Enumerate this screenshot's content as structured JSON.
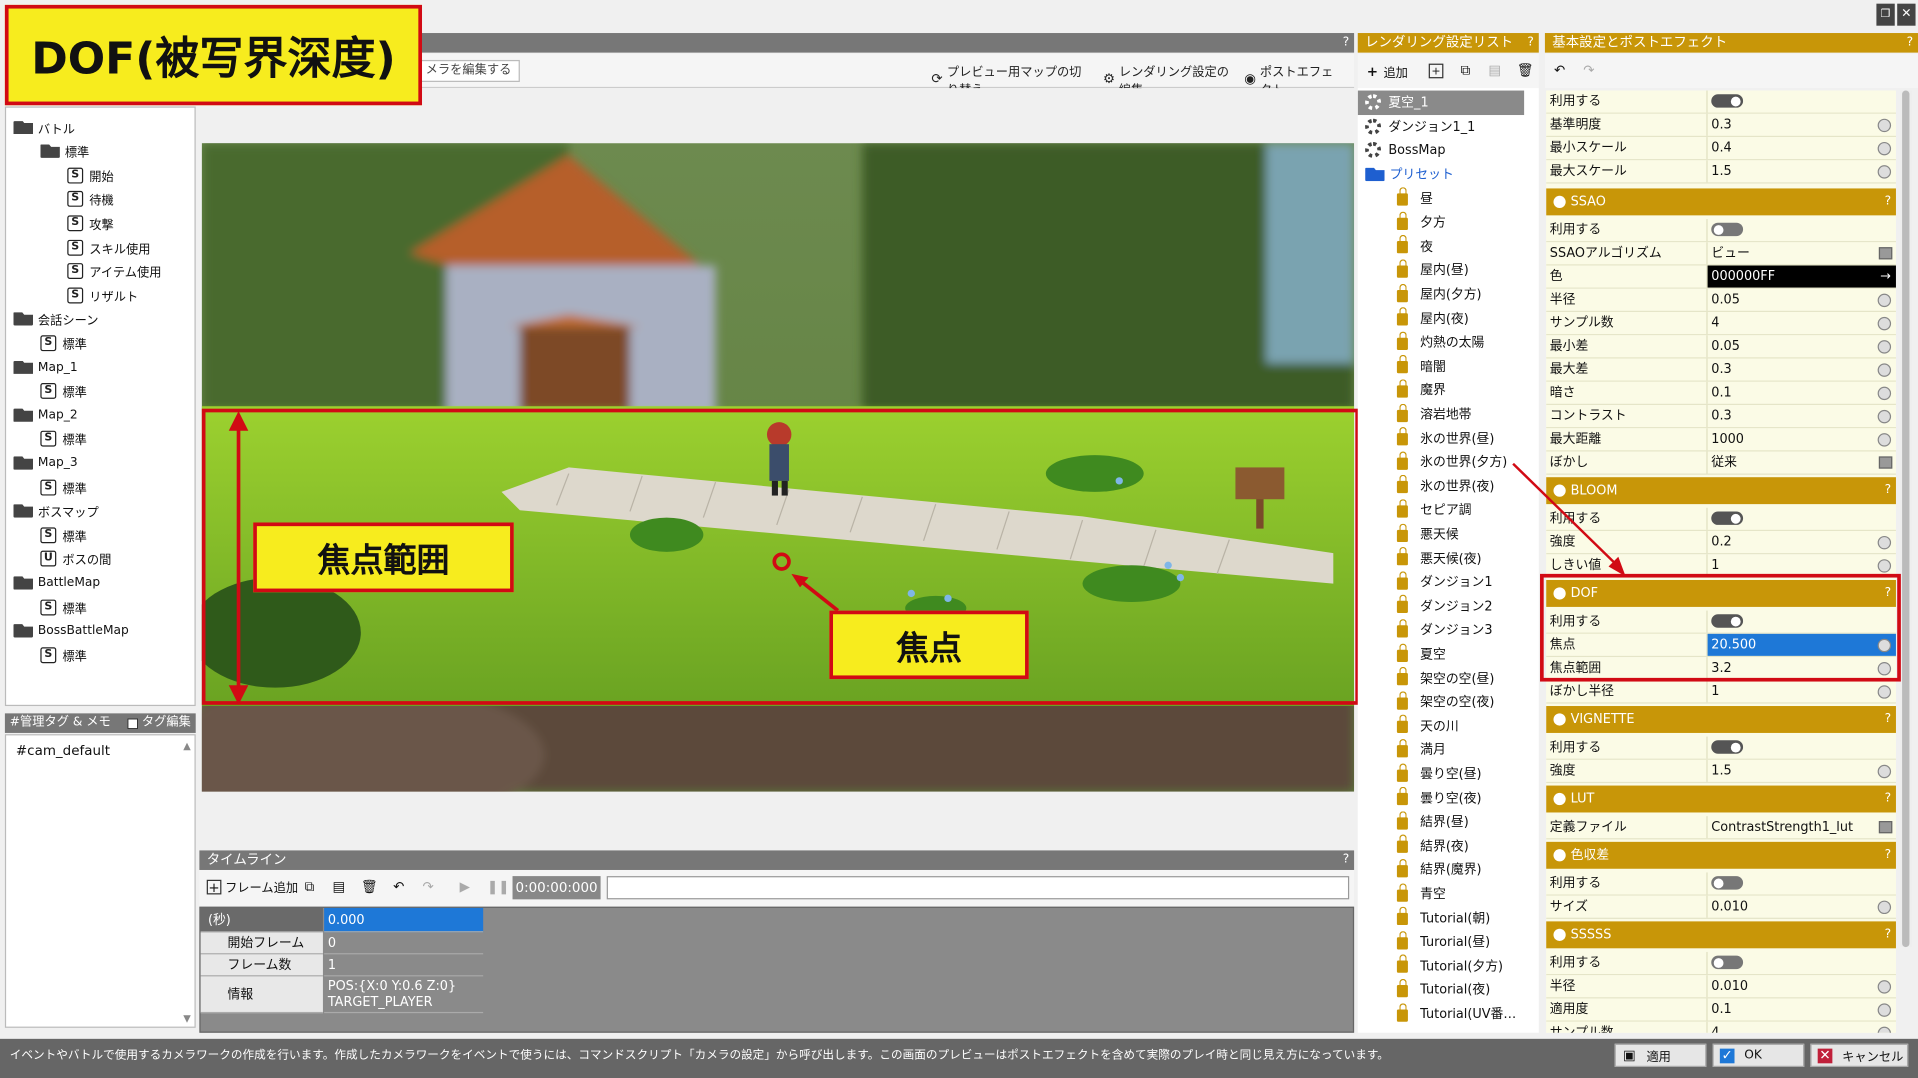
{
  "title_badge": "DOF(被写界深度)",
  "toolbar": {
    "edit_camera": "メラを編集する",
    "switch_preview_map": "プレビュー用マップの切り替え",
    "edit_rendering": "レンダリング設定の編集",
    "post_effect": "ポストエフェクト"
  },
  "tree": [
    {
      "label": "バトル",
      "kind": "folder",
      "depth": 0
    },
    {
      "label": "標準",
      "kind": "folder",
      "depth": 1
    },
    {
      "label": "開始",
      "kind": "script",
      "depth": 2
    },
    {
      "label": "待機",
      "kind": "script",
      "depth": 2
    },
    {
      "label": "攻撃",
      "kind": "script",
      "depth": 2
    },
    {
      "label": "スキル使用",
      "kind": "script",
      "depth": 2
    },
    {
      "label": "アイテム使用",
      "kind": "script",
      "depth": 2
    },
    {
      "label": "リザルト",
      "kind": "script",
      "depth": 2
    },
    {
      "label": "会話シーン",
      "kind": "folder",
      "depth": 0
    },
    {
      "label": "標準",
      "kind": "script",
      "depth": 1
    },
    {
      "label": "Map_1",
      "kind": "folder",
      "depth": 0
    },
    {
      "label": "標準",
      "kind": "script",
      "depth": 1
    },
    {
      "label": "Map_2",
      "kind": "folder",
      "depth": 0
    },
    {
      "label": "標準",
      "kind": "script",
      "depth": 1
    },
    {
      "label": "Map_3",
      "kind": "folder",
      "depth": 0
    },
    {
      "label": "標準",
      "kind": "script",
      "depth": 1
    },
    {
      "label": "ボスマップ",
      "kind": "folder",
      "depth": 0
    },
    {
      "label": "標準",
      "kind": "script",
      "depth": 1
    },
    {
      "label": "ボスの間",
      "kind": "unity",
      "depth": 1
    },
    {
      "label": "BattleMap",
      "kind": "folder",
      "depth": 0
    },
    {
      "label": "標準",
      "kind": "script",
      "depth": 1
    },
    {
      "label": "BossBattleMap",
      "kind": "folder",
      "depth": 0
    },
    {
      "label": "標準",
      "kind": "script",
      "depth": 1
    }
  ],
  "tags": {
    "header": "#管理タグ & メモ",
    "edit_label": "タグ編集",
    "value": "#cam_default"
  },
  "annotations": {
    "focus_range": "焦点範囲",
    "focus": "焦点"
  },
  "timeline": {
    "header": "タイムライン",
    "add_frame": "フレーム追加",
    "time": "0:00:00:000",
    "rows": [
      {
        "label": "(秒)",
        "value": "0.000"
      },
      {
        "label": "開始フレーム",
        "value": "0"
      },
      {
        "label": "フレーム数",
        "value": "1"
      },
      {
        "label": "情報",
        "value": "POS:{X:0 Y:0.6 Z:0}",
        "value2": "TARGET_PLAYER"
      }
    ]
  },
  "render_list": {
    "header": "レンダリング設定リスト",
    "add": "追加",
    "items": [
      "夏空_1",
      "ダンジョン1_1",
      "BossMap"
    ],
    "preset_folder": "プリセット",
    "presets": [
      "昼",
      "夕方",
      "夜",
      "屋内(昼)",
      "屋内(夕方)",
      "屋内(夜)",
      "灼熱の太陽",
      "暗闇",
      "魔界",
      "溶岩地帯",
      "氷の世界(昼)",
      "氷の世界(夕方)",
      "氷の世界(夜)",
      "セピア調",
      "悪天候",
      "悪天候(夜)",
      "ダンジョン1",
      "ダンジョン2",
      "ダンジョン3",
      "夏空",
      "架空の空(昼)",
      "架空の空(夜)",
      "天の川",
      "満月",
      "曇り空(昼)",
      "曇り空(夜)",
      "結界(昼)",
      "結界(夜)",
      "結界(魔界)",
      "青空",
      "Tutorial(朝)",
      "Turorial(昼)",
      "Tutorial(夕方)",
      "Tutorial(夜)",
      "Tutorial(UV番…"
    ]
  },
  "props": {
    "header": "基本設定とポストエフェクト",
    "basic": [
      {
        "label": "利用する",
        "type": "toggle",
        "on": true
      },
      {
        "label": "基準明度",
        "value": "0.3"
      },
      {
        "label": "最小スケール",
        "value": "0.4"
      },
      {
        "label": "最大スケール",
        "value": "1.5"
      }
    ],
    "ssao": {
      "title": "SSAO",
      "rows": [
        {
          "label": "利用する",
          "type": "toggle",
          "on": false
        },
        {
          "label": "SSAOアルゴリズム",
          "value": "ビュー",
          "type": "select"
        },
        {
          "label": "色",
          "value": "000000FF",
          "type": "color"
        },
        {
          "label": "半径",
          "value": "0.05"
        },
        {
          "label": "サンプル数",
          "value": "4"
        },
        {
          "label": "最小差",
          "value": "0.05"
        },
        {
          "label": "最大差",
          "value": "0.3"
        },
        {
          "label": "暗さ",
          "value": "0.1"
        },
        {
          "label": "コントラスト",
          "value": "0.3"
        },
        {
          "label": "最大距離",
          "value": "1000"
        },
        {
          "label": "ぼかし",
          "value": "従来",
          "type": "select"
        }
      ]
    },
    "bloom": {
      "title": "BLOOM",
      "rows": [
        {
          "label": "利用する",
          "type": "toggle",
          "on": true
        },
        {
          "label": "強度",
          "value": "0.2"
        },
        {
          "label": "しきい値",
          "value": "1"
        }
      ]
    },
    "dof": {
      "title": "DOF",
      "rows": [
        {
          "label": "利用する",
          "type": "toggle",
          "on": true
        },
        {
          "label": "焦点",
          "value": "20.500",
          "selected": true
        },
        {
          "label": "焦点範囲",
          "value": "3.2"
        },
        {
          "label": "ぼかし半径",
          "value": "1"
        }
      ]
    },
    "vignette": {
      "title": "VIGNETTE",
      "rows": [
        {
          "label": "利用する",
          "type": "toggle",
          "on": true
        },
        {
          "label": "強度",
          "value": "1.5"
        }
      ]
    },
    "lut": {
      "title": "LUT",
      "rows": [
        {
          "label": "定義ファイル",
          "value": "ContrastStrength1_lut",
          "type": "select"
        }
      ]
    },
    "chroma": {
      "title": "色収差",
      "rows": [
        {
          "label": "利用する",
          "type": "toggle",
          "on": false
        },
        {
          "label": "サイズ",
          "value": "0.010"
        }
      ]
    },
    "sssss": {
      "title": "SSSSS",
      "rows": [
        {
          "label": "利用する",
          "type": "toggle",
          "on": false
        },
        {
          "label": "半径",
          "value": "0.010"
        },
        {
          "label": "適用度",
          "value": "0.1"
        },
        {
          "label": "サンプル数",
          "value": "4"
        }
      ]
    }
  },
  "status_text": "イベントやバトルで使用するカメラワークの作成を行います。作成したカメラワークをイベントで使うには、コマンドスクリプト「カメラの設定」から呼び出します。この画面のプレビューはポストエフェクトを含めて実際のプレイ時と同じ見え方になっています。",
  "footer": {
    "apply": "適用",
    "ok": "OK",
    "cancel": "キャンセル"
  },
  "colors": {
    "accent_gold": "#c89608",
    "annotation_red": "#d10a14",
    "annotation_yellow": "#f7ec1e",
    "selection_blue": "#1e78d7"
  }
}
